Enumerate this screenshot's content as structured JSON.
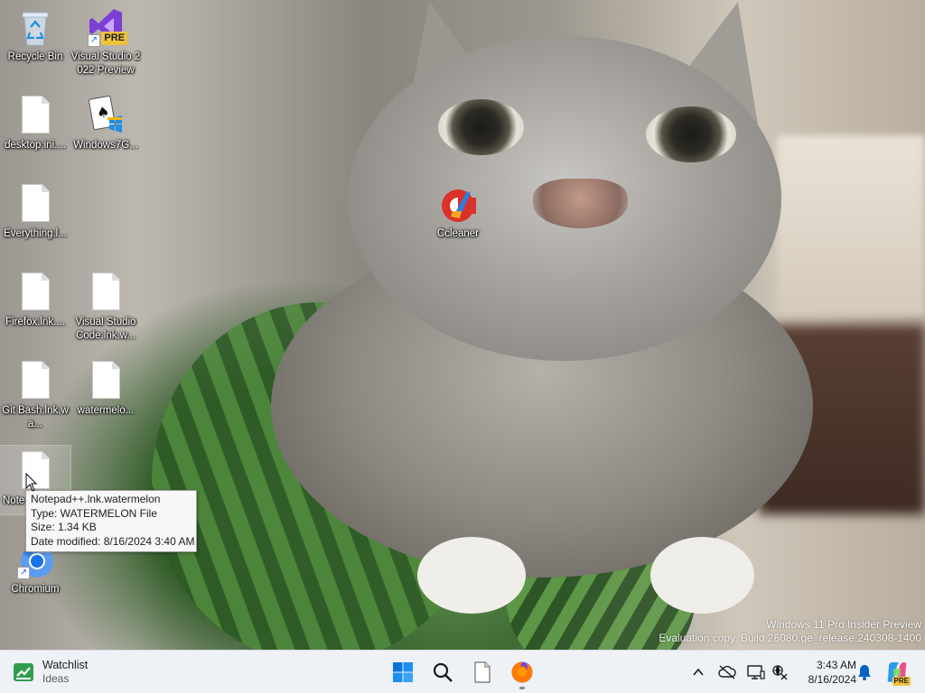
{
  "desktop": {
    "icons": [
      {
        "id": "recycle-bin",
        "label": "Recycle Bin"
      },
      {
        "id": "visual-studio-2022-preview",
        "label": "Visual Studio 2022 Preview",
        "badge": "PRE"
      },
      {
        "id": "desktop-ini",
        "label": "desktop.ini...."
      },
      {
        "id": "windows7g",
        "label": "Windows7G..."
      },
      {
        "id": "ccleaner",
        "label": "Ccleaner"
      },
      {
        "id": "everything",
        "label": "Everything.l..."
      },
      {
        "id": "firefox-lnk",
        "label": "Firefox.lnk...."
      },
      {
        "id": "vscode-lnk",
        "label": "Visual Studio Code.lnk.w..."
      },
      {
        "id": "git-bash-lnk",
        "label": "Git Bash.lnk.wa..."
      },
      {
        "id": "watermelon",
        "label": "watermelo..."
      },
      {
        "id": "notepadpp-lnk",
        "label": "Note"
      },
      {
        "id": "chromium",
        "label": "Chromium"
      }
    ]
  },
  "tooltip": {
    "name": "Notepad++.lnk.watermelon",
    "type": "Type: WATERMELON File",
    "size": "Size: 1.34 KB",
    "modified": "Date modified: 8/16/2024 3:40 AM"
  },
  "watermark": {
    "line1": "Windows 11 Pro Insider Preview",
    "line2": "Evaluation copy. Build 26080.ge_release.240308-1400"
  },
  "taskbar": {
    "widget": {
      "title": "Watchlist",
      "subtitle": "Ideas",
      "icon": "stock-chart-icon"
    },
    "pinned": [
      {
        "id": "start",
        "icon": "windows-logo-icon"
      },
      {
        "id": "search",
        "icon": "search-icon"
      },
      {
        "id": "file",
        "icon": "document-icon"
      },
      {
        "id": "firefox",
        "icon": "firefox-icon",
        "active": true
      }
    ],
    "tray": {
      "icons": [
        "chevron-up-icon",
        "cloud-off-icon",
        "display-icon",
        "network-icon",
        "bell-icon",
        "copilot-icon"
      ],
      "time": "3:43 AM",
      "date": "8/16/2024",
      "copilot_badge": "PRE"
    }
  },
  "colors": {
    "taskbar_bg": "#eef1f5",
    "win_blue": "#0a74d9",
    "firefox_orange": "#ff7a00",
    "watchlist_green": "#2f9e4f",
    "vs_purple": "#7b3fd4"
  }
}
